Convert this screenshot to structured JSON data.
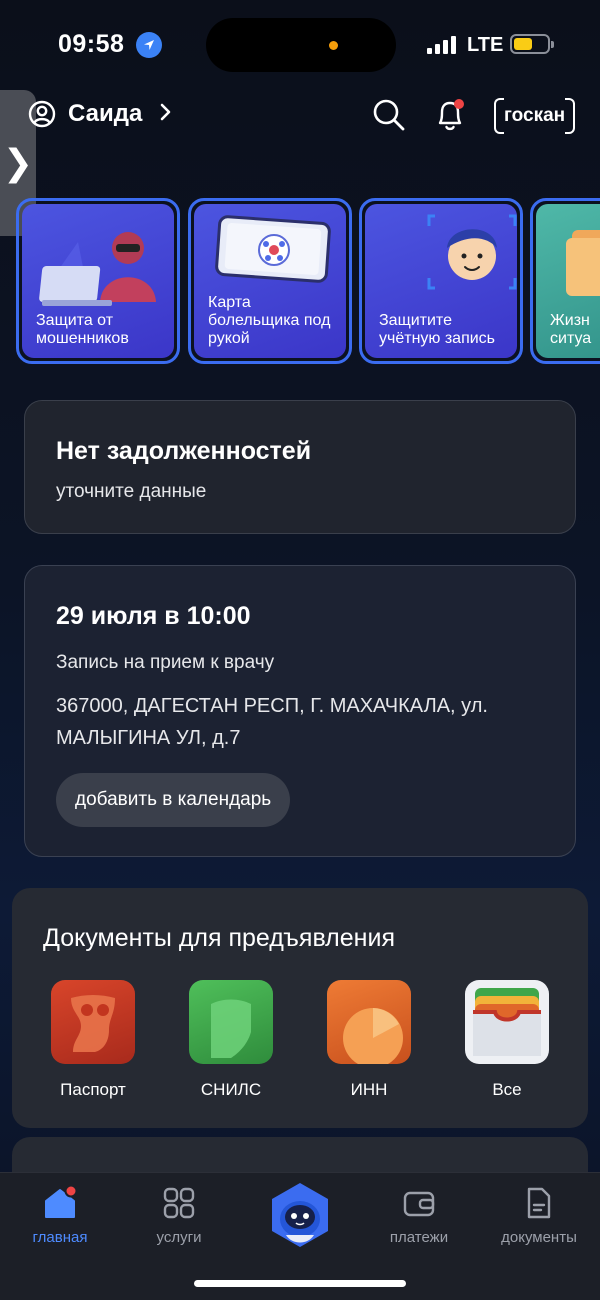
{
  "status_bar": {
    "time": "09:58",
    "network": "LTE",
    "battery_level": 0.55,
    "battery_color": "#facc15"
  },
  "header": {
    "user_name": "Саида",
    "scan_label": "госкан",
    "notification_dot_color": "#ef4444"
  },
  "stories": [
    {
      "label": "Защита от мошенников"
    },
    {
      "label": "Карта болельщика под рукой"
    },
    {
      "label": "Защитите учётную запись"
    },
    {
      "label": "Жизн ситуа"
    }
  ],
  "debts_card": {
    "title": "Нет задолженностей",
    "subtitle": "уточните данные"
  },
  "appointment_card": {
    "date": "29 июля в 10:00",
    "description": "Запись на прием к врачу",
    "address": "367000, ДАГЕСТАН РЕСП, Г. МАХАЧКАЛА, ул. МАЛЫГИНА УЛ, д.7",
    "calendar_button": "добавить в календарь"
  },
  "documents": {
    "title": "Документы для предъявления",
    "items": [
      {
        "name": "Паспорт",
        "color": "#c2351f"
      },
      {
        "name": "СНИЛС",
        "color": "#3fa64a"
      },
      {
        "name": "ИНН",
        "color": "#e0672a"
      },
      {
        "name": "Все",
        "color": "#e5e7eb"
      }
    ]
  },
  "tabbar": {
    "accent": "#4e8bff",
    "items": [
      {
        "label": "главная",
        "active": true
      },
      {
        "label": "услуги",
        "active": false
      },
      {
        "label": "платежи",
        "active": false
      },
      {
        "label": "документы",
        "active": false
      }
    ]
  }
}
